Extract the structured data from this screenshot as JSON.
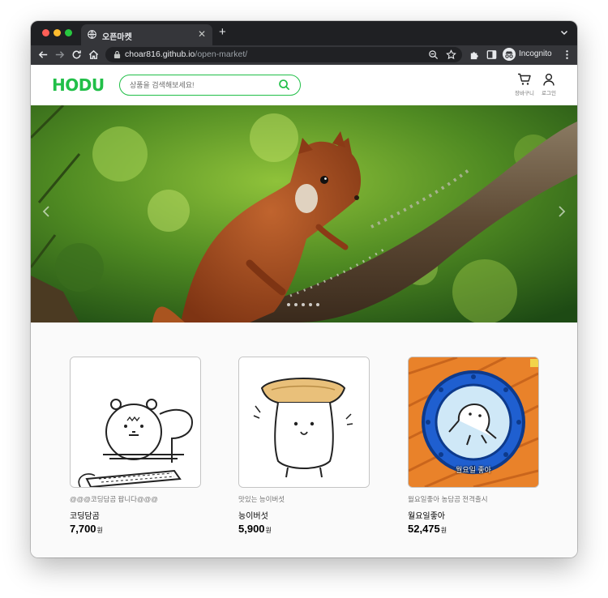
{
  "browser": {
    "tab_title": "오픈마켓",
    "url_host": "choar816.github.io",
    "url_path": "/open-market/",
    "incognito_label": "Incognito"
  },
  "header": {
    "logo": "HODU",
    "search_placeholder": "상품을 검색해보세요!",
    "cart_label": "장바구니",
    "login_label": "로그인"
  },
  "colors": {
    "brand": "#21bf48"
  },
  "banner": {
    "slide_count": 5
  },
  "products": [
    {
      "seller": "@@@코딩담곰 팝니다@@@",
      "name": "코딩담곰",
      "price": "7,700",
      "unit": "원"
    },
    {
      "seller": "맛있는 능이버섯",
      "name": "능이버섯",
      "price": "5,900",
      "unit": "원"
    },
    {
      "seller": "월요일좋아 농담곰 전격출시",
      "name": "월요일좋아",
      "price": "52,475",
      "unit": "원",
      "image_caption": "월요일 좋아"
    }
  ]
}
